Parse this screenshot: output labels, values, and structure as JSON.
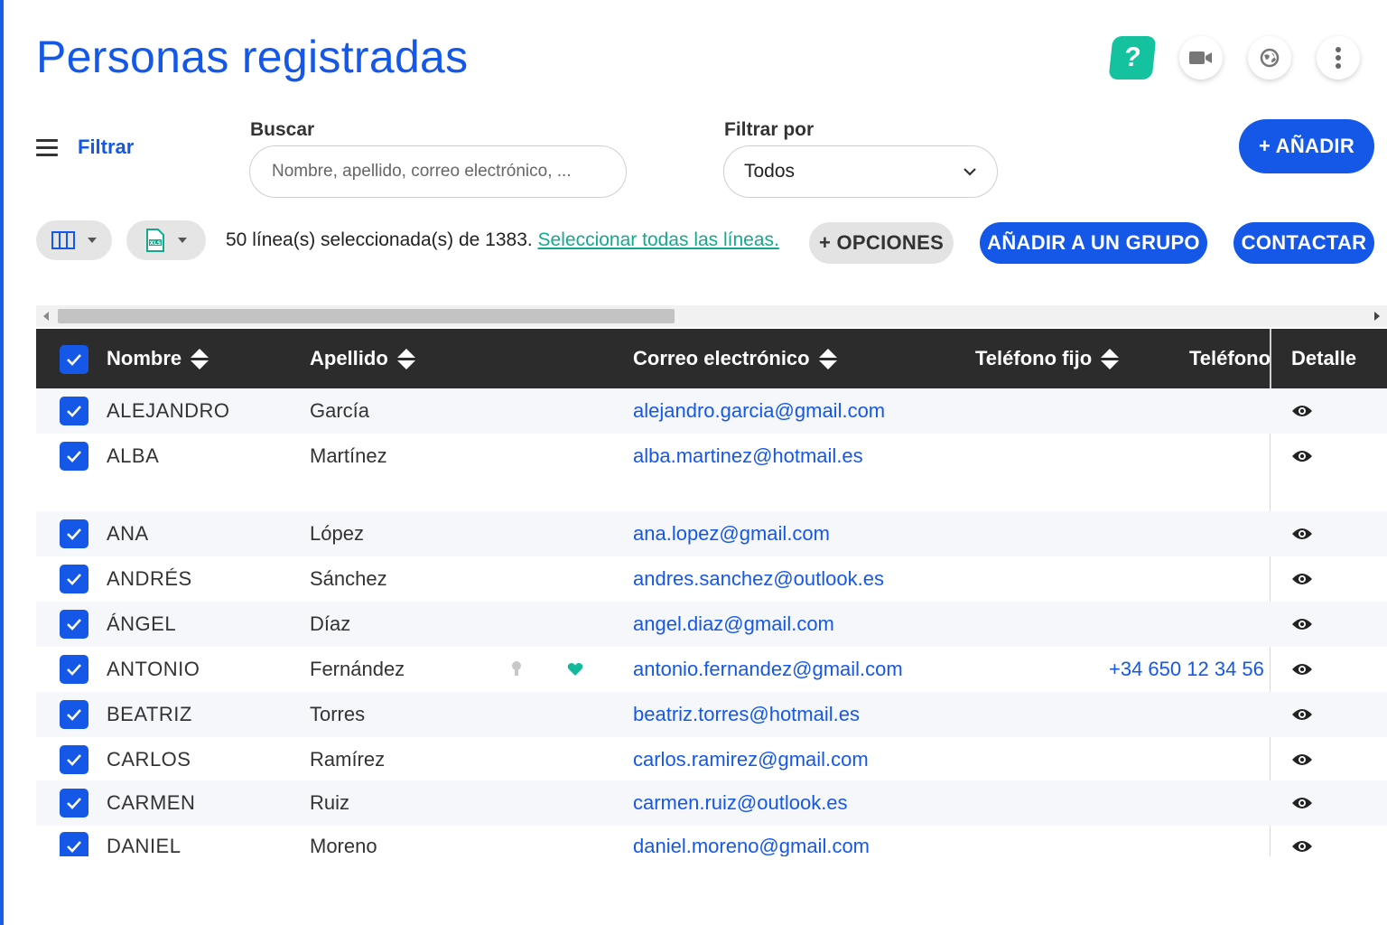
{
  "page": {
    "title": "Personas registradas"
  },
  "header_icons": {
    "help": "?",
    "help_icon": "help-icon",
    "video_icon": "video-camera-icon",
    "globe_icon": "globe-icon",
    "more_icon": "more-vertical-icon"
  },
  "filter": {
    "toggle_label": "Filtrar",
    "search_label": "Buscar",
    "search_placeholder": "Nombre, apellido, correo electrónico, ...",
    "filter_by_label": "Filtrar por",
    "filter_by_value": "Todos"
  },
  "actions": {
    "add_label": "+ AÑADIR",
    "selection_text": "50 línea(s) seleccionada(s) de 1383.",
    "select_all_link": "Seleccionar todas las líneas.",
    "options_label": "+ OPCIONES",
    "add_to_group_label": "AÑADIR A UN GRUPO",
    "contact_label": "CONTACTAR",
    "columns_icon": "columns-icon",
    "xls_icon": "xls-export-icon"
  },
  "table": {
    "columns": {
      "name": "Nombre",
      "last": "Apellido",
      "email": "Correo electrónico",
      "landline": "Teléfono fijo",
      "phone": "Teléfono",
      "detail": "Detalle"
    },
    "rows": [
      {
        "name": "ALEJANDRO",
        "last": "García",
        "email": "alejandro.garcia@gmail.com",
        "phone": ""
      },
      {
        "name": "ALBA",
        "last": "Martínez",
        "email": "alba.martinez@hotmail.es",
        "phone": ""
      },
      {
        "name": "ANA",
        "last": "López",
        "email": "ana.lopez@gmail.com",
        "phone": ""
      },
      {
        "name": "ANDRÉS",
        "last": "Sánchez",
        "email": "andres.sanchez@outlook.es",
        "phone": ""
      },
      {
        "name": "ÁNGEL",
        "last": "Díaz",
        "email": "angel.diaz@gmail.com",
        "phone": ""
      },
      {
        "name": "ANTONIO",
        "last": "Fernández",
        "email": "antonio.fernandez@gmail.com",
        "phone": "+34 650 12 34 56"
      },
      {
        "name": "BEATRIZ",
        "last": "Torres",
        "email": "beatriz.torres@hotmail.es",
        "phone": ""
      },
      {
        "name": "CARLOS",
        "last": "Ramírez",
        "email": "carlos.ramirez@gmail.com",
        "phone": ""
      },
      {
        "name": "CARMEN",
        "last": "Ruiz",
        "email": "carmen.ruiz@outlook.es",
        "phone": ""
      },
      {
        "name": "DANIEL",
        "last": "Moreno",
        "email": "daniel.moreno@gmail.com",
        "phone": ""
      }
    ]
  },
  "colors": {
    "primary": "#1558e8",
    "help_green": "#14c2a0",
    "link_green": "#14a98c",
    "header_dark": "#2c2c2c"
  }
}
